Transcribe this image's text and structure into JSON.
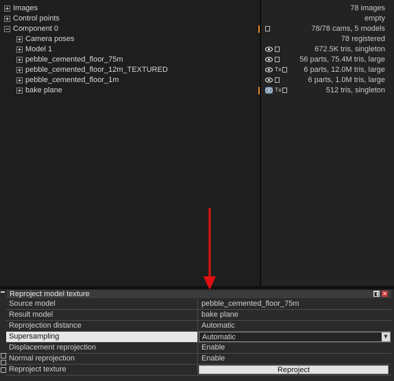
{
  "tree": [
    {
      "label": "Images",
      "expander": "plus",
      "indent": 0
    },
    {
      "label": "Control points",
      "expander": "plus",
      "indent": 0
    },
    {
      "label": "Component 0",
      "expander": "minus",
      "indent": 0,
      "selected": true
    },
    {
      "label": "Camera poses",
      "expander": "plus",
      "indent": 1
    },
    {
      "label": "Model 1",
      "expander": "plus",
      "indent": 1
    },
    {
      "label": "pebble_cemented_floor_75m",
      "expander": "plus",
      "indent": 1
    },
    {
      "label": "pebble_cemented_floor_12m_TEXTURED",
      "expander": "plus",
      "indent": 1
    },
    {
      "label": "pebble_cemented_floor_1m",
      "expander": "plus",
      "indent": 1
    },
    {
      "label": "bake plane",
      "expander": "plus",
      "indent": 1,
      "selected": true
    }
  ],
  "info": [
    {
      "text": "78 images",
      "icons": []
    },
    {
      "text": "empty",
      "icons": []
    },
    {
      "text": "78/78 cams, 5 models",
      "icons": [
        "mini-icon"
      ]
    },
    {
      "text": "78 registered",
      "icons": []
    },
    {
      "text": "672.5K tris, singleton",
      "icons": [
        "eye-icon",
        "mini-icon"
      ]
    },
    {
      "text": "56 parts, 75.4M tris, large",
      "icons": [
        "eye-icon",
        "mini-icon"
      ]
    },
    {
      "text": "6 parts, 12.0M tris, large",
      "icons": [
        "eye-icon",
        "tx-icon",
        "mini-icon"
      ]
    },
    {
      "text": "6 parts, 1.0M tris, large",
      "icons": [
        "eye-icon",
        "mini-icon"
      ]
    },
    {
      "text": "512 tris, singleton",
      "icons": [
        "eye-icon-active",
        "tx-icon",
        "mini-icon"
      ]
    }
  ],
  "tx_label": "Tx",
  "panel": {
    "title": "Reproject model texture",
    "float_label": "◧",
    "close_label": "✕",
    "rows": [
      {
        "name": "Source model",
        "value": "pebble_cemented_floor_75m"
      },
      {
        "name": "Result model",
        "value": "bake plane"
      },
      {
        "name": "Reprojection distance",
        "value": "Automatic"
      },
      {
        "name": "Supersampling",
        "value": "Automatic",
        "dropdown": true
      },
      {
        "name": "Displacement reprojection",
        "value": "Enable"
      },
      {
        "name": "Normal reprojection",
        "value": "Enable"
      },
      {
        "name": "Reproject texture",
        "button": "Reproject"
      }
    ]
  },
  "colors": {
    "accent_marker": "#e08a2a",
    "arrow": "#e01010",
    "close": "#c23a3a"
  }
}
